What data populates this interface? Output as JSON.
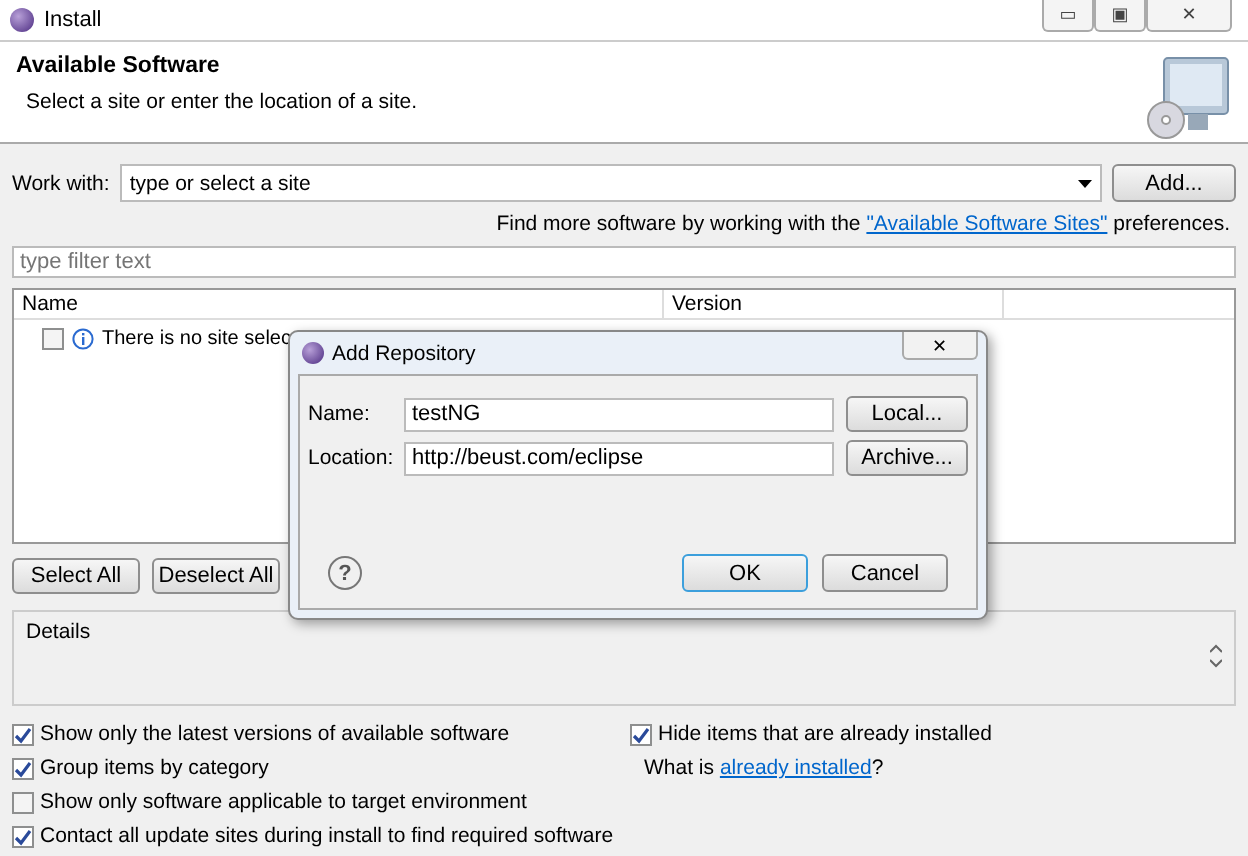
{
  "window": {
    "title": "Install",
    "controls": [
      "▭",
      "▣",
      "✕"
    ]
  },
  "header": {
    "title": "Available Software",
    "subtitle": "Select a site or enter the location of a site."
  },
  "work_with": {
    "label": "Work with:",
    "value": "type or select a site",
    "button": "Add..."
  },
  "hint": {
    "before": "Find more software by working with the ",
    "link": "\"Available Software Sites\"",
    "after": " preferences."
  },
  "filter": {
    "placeholder": "type filter text"
  },
  "table": {
    "columns": [
      "Name",
      "Version"
    ],
    "rows": [
      {
        "checked": false,
        "name": "There is no site selec"
      }
    ]
  },
  "table_buttons": [
    "Select All",
    "Deselect All"
  ],
  "details": {
    "title": "Details"
  },
  "options": [
    {
      "label": "Show only the latest versions of available software",
      "checked": true
    },
    {
      "label": "Group items by category",
      "checked": true
    },
    {
      "label": "Show only software applicable to target environment",
      "checked": false
    },
    {
      "label": "Contact all update sites during install to find required software",
      "checked": true
    }
  ],
  "right_options": [
    {
      "label": "Hide items that are already installed",
      "checked": true
    }
  ],
  "installed_hint": {
    "before": "What is ",
    "link": "already installed",
    "after": "?"
  },
  "dialog": {
    "title": "Add Repository",
    "close": "✕",
    "fields": [
      {
        "label": "Name:",
        "value": "testNG",
        "button": "Local..."
      },
      {
        "label": "Location:",
        "value": "http://beust.com/eclipse",
        "button": "Archive..."
      }
    ],
    "help": "?",
    "buttons": [
      {
        "label": "OK",
        "default": true
      },
      {
        "label": "Cancel",
        "default": false
      }
    ]
  }
}
